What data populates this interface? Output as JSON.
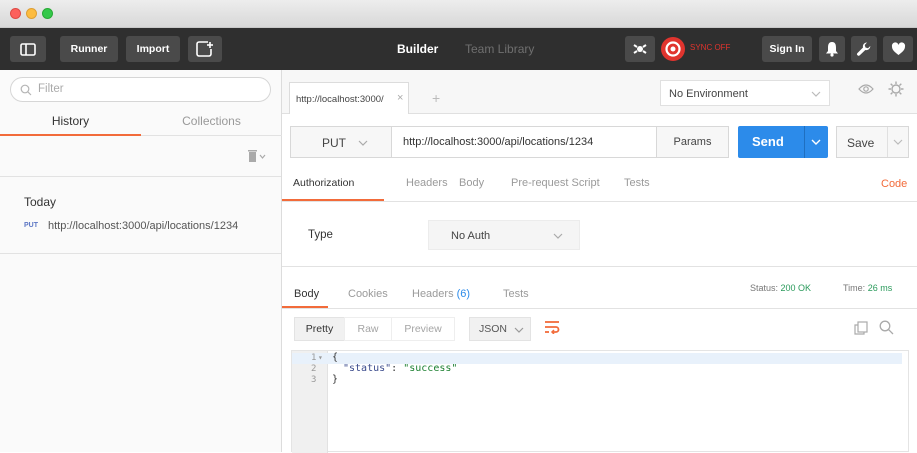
{
  "toolbar": {
    "runner_label": "Runner",
    "import_label": "Import",
    "builder_tab": "Builder",
    "team_library_tab": "Team Library",
    "sync_label": "SYNC OFF",
    "sign_in_label": "Sign In"
  },
  "sidebar": {
    "filter_placeholder": "Filter",
    "tabs": [
      "History",
      "Collections"
    ],
    "group_title": "Today",
    "history_items": [
      {
        "method": "PUT",
        "url": "http://localhost:3000/api/locations/1234"
      }
    ]
  },
  "request_tab": {
    "label": "http://localhost:3000/",
    "close": "×",
    "add": "+"
  },
  "environment": {
    "selected": "No Environment"
  },
  "request": {
    "method": "PUT",
    "url": "http://localhost:3000/api/locations/1234",
    "params_label": "Params",
    "send_label": "Send",
    "save_label": "Save"
  },
  "request_tabs": [
    "Authorization",
    "Headers",
    "Body",
    "Pre-request Script",
    "Tests"
  ],
  "code_link": "Code",
  "auth": {
    "type_label": "Type",
    "type_value": "No Auth"
  },
  "response": {
    "tabs": [
      "Body",
      "Cookies",
      "Headers",
      "Tests"
    ],
    "headers_count": "(6)",
    "status_label": "Status:",
    "status_value": "200 OK",
    "time_label": "Time:",
    "time_value": "26 ms",
    "view_modes": [
      "Pretty",
      "Raw",
      "Preview"
    ],
    "format": "JSON",
    "line_numbers": [
      "1",
      "2",
      "3"
    ],
    "code_lines": [
      {
        "text": "{"
      },
      {
        "key": "\"status\"",
        "colon": ": ",
        "value": "\"success\""
      },
      {
        "text": "}"
      }
    ]
  },
  "colors": {
    "accent": "#f26b3a",
    "send_blue": "#2c8bea",
    "status_green": "#2a9a5b",
    "toolbar": "#2f2f2f"
  }
}
